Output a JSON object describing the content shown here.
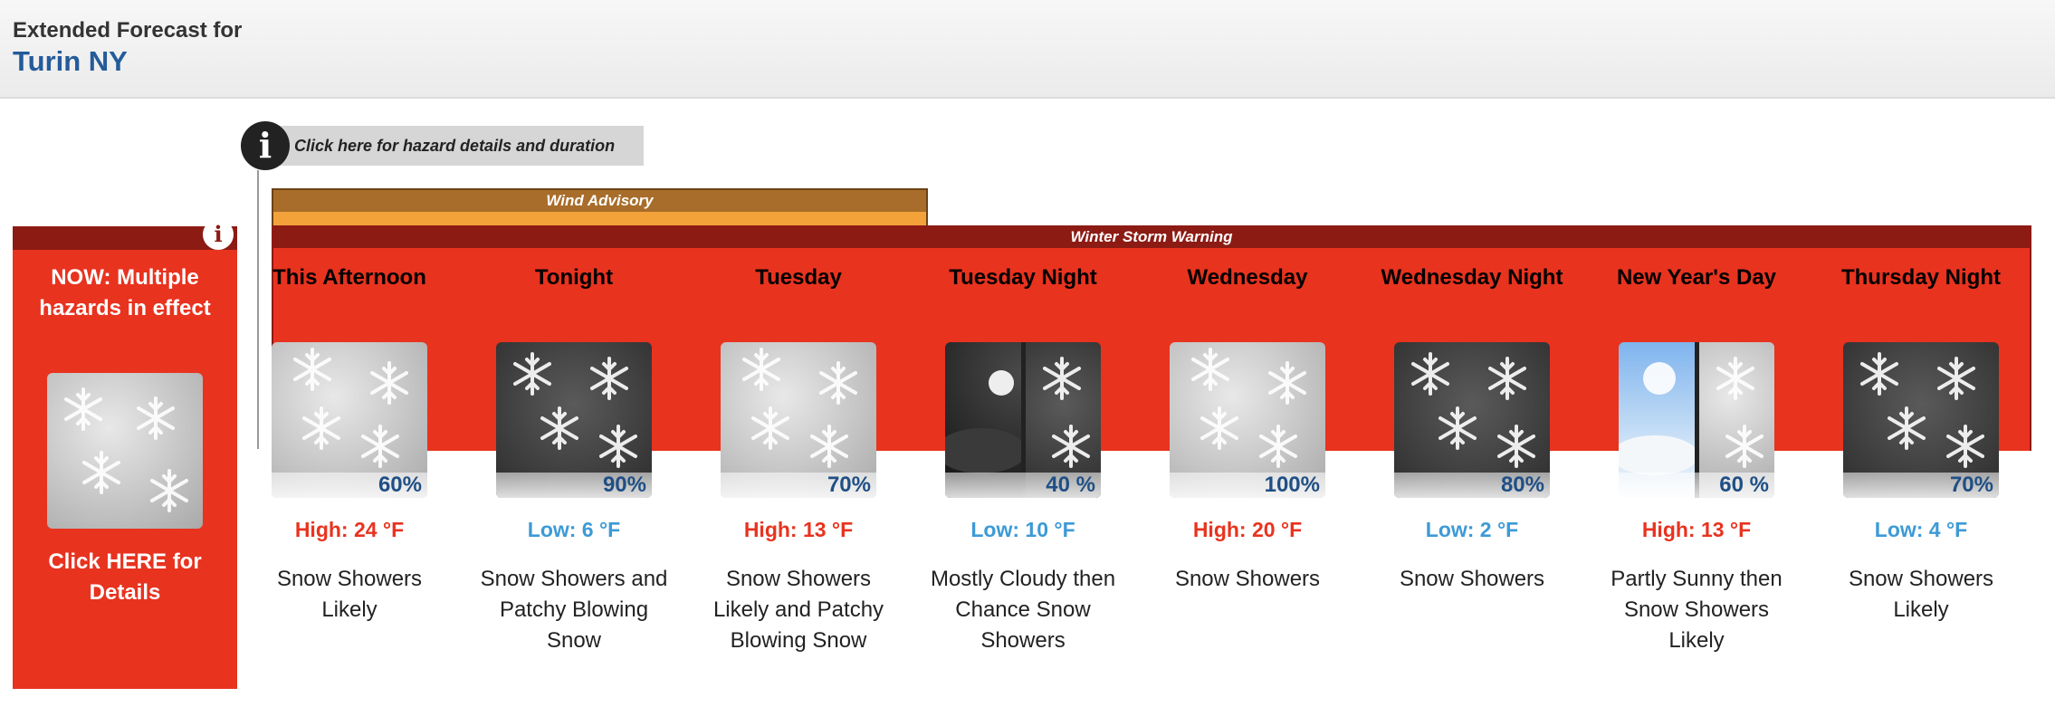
{
  "header": {
    "pre_title": "Extended Forecast for",
    "location": "Turin NY"
  },
  "hazard_link": {
    "label": "Click here for hazard details and duration"
  },
  "hazards": {
    "wind_advisory": "Wind Advisory",
    "winter_storm_warning": "Winter Storm Warning"
  },
  "now": {
    "message": "NOW: Multiple hazards in effect",
    "details": "Click HERE for Details"
  },
  "periods": [
    {
      "name": "This Afternoon",
      "pop": "60%",
      "temp": "High: 24 °F",
      "desc": "Snow Showers Likely",
      "icon": "snow-showers-icon"
    },
    {
      "name": "Tonight",
      "pop": "90%",
      "temp": "Low: 6 °F",
      "desc": "Snow Showers and Patchy Blowing Snow",
      "icon": "night-snow-showers-icon"
    },
    {
      "name": "Tuesday",
      "pop": "70%",
      "temp": "High: 13 °F",
      "desc": "Snow Showers Likely and Patchy Blowing Snow",
      "icon": "snow-showers-icon"
    },
    {
      "name": "Tuesday Night",
      "pop": "40 %",
      "temp": "Low: 10 °F",
      "desc": "Mostly Cloudy then Chance Snow Showers",
      "icon": "cloudy-night-then-snow-icon"
    },
    {
      "name": "Wednesday",
      "pop": "100%",
      "temp": "High: 20 °F",
      "desc": "Snow Showers",
      "icon": "snow-showers-icon"
    },
    {
      "name": "Wednesday Night",
      "pop": "80%",
      "temp": "Low: 2 °F",
      "desc": "Snow Showers",
      "icon": "night-snow-showers-icon"
    },
    {
      "name": "New Year's Day",
      "pop": "60 %",
      "temp": "High: 13 °F",
      "desc": "Partly Sunny then Snow Showers Likely",
      "icon": "partly-sunny-then-snow-icon"
    },
    {
      "name": "Thursday Night",
      "pop": "70%",
      "temp": "Low: 4 °F",
      "desc": "Snow Showers Likely",
      "icon": "night-snow-showers-icon"
    }
  ],
  "colors": {
    "high": "#e8331f",
    "low": "#3d9ad6",
    "warning_red": "#e8331f",
    "advisory_brown": "#a86d2a"
  }
}
